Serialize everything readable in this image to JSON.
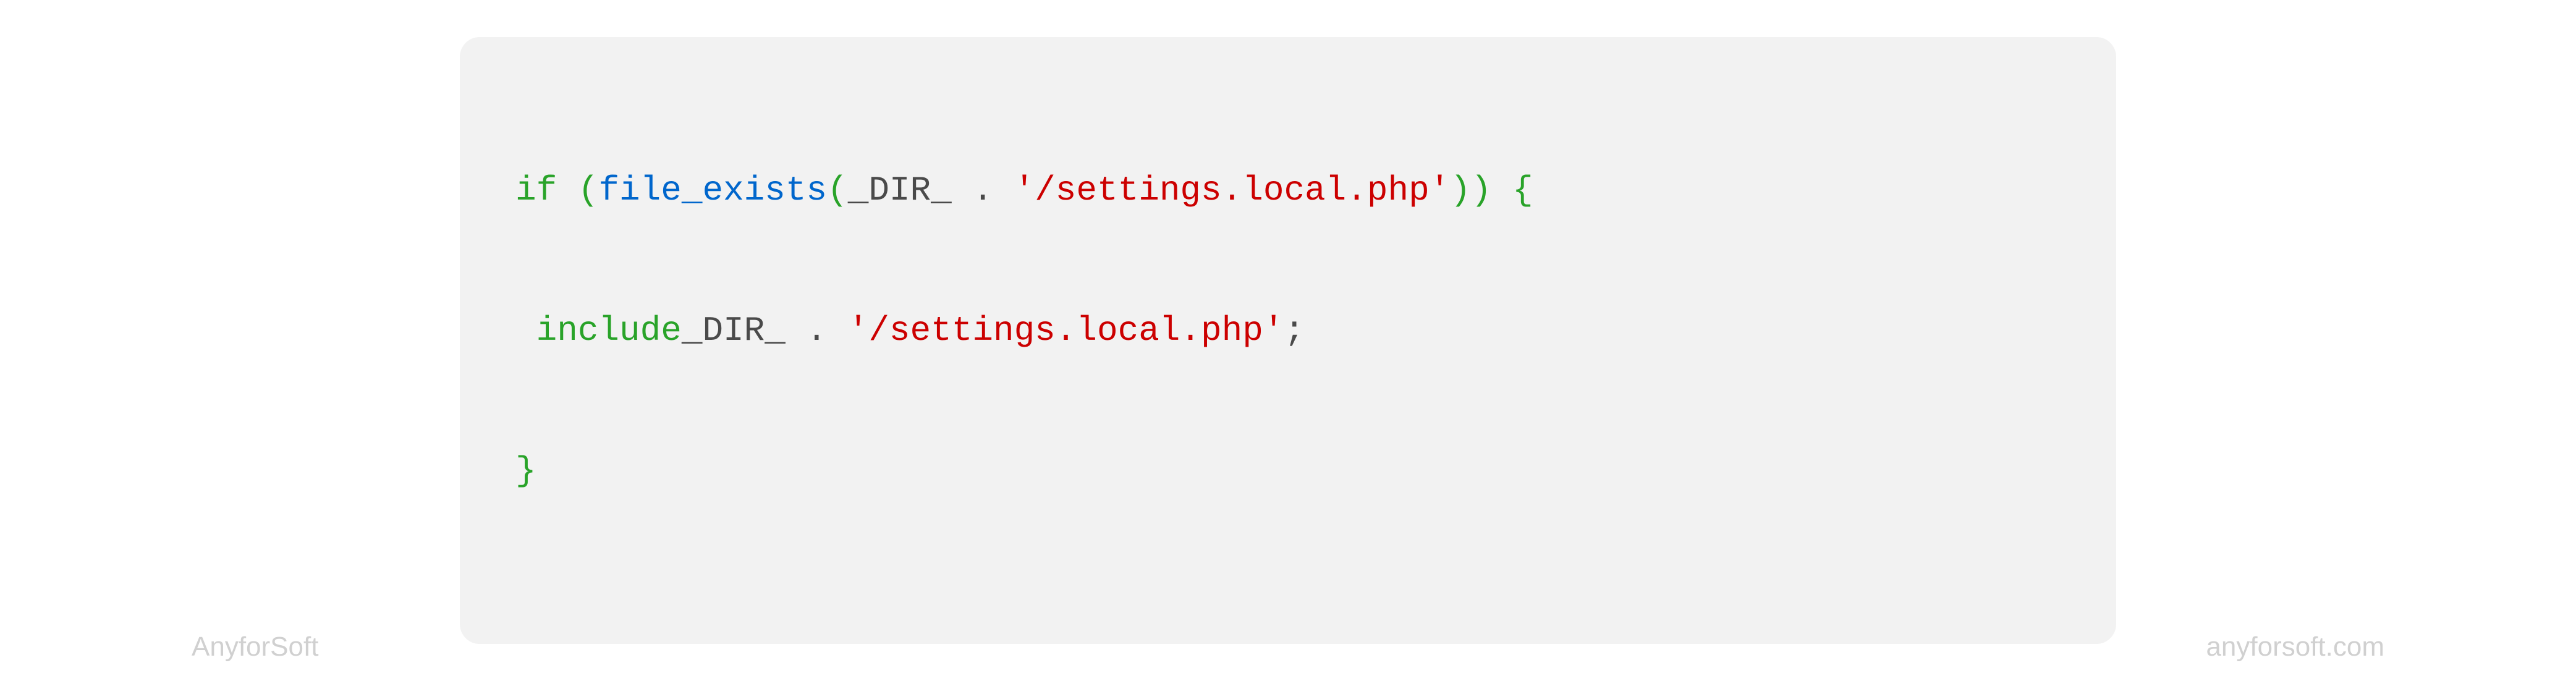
{
  "code": {
    "line1": {
      "if": "if",
      "space1": " ",
      "paren_open1": "(",
      "fn_name": "file_exists",
      "paren_open2": "(",
      "dir_const": "_DIR_ ",
      "dot1": ".",
      "space2": " ",
      "string1": "'/settings.local.php'",
      "paren_close1": ")",
      "paren_close2": ")",
      "space3": " ",
      "brace_open": "{"
    },
    "line2": {
      "indent": " ",
      "include": "include",
      "dir_const": "_DIR_ ",
      "dot": ".",
      "space": " ",
      "string": "'/settings.local.php'",
      "semi": ";"
    },
    "line3": {
      "brace_close": "}"
    }
  },
  "footer": {
    "brand": "AnyforSoft",
    "url": "anyforsoft.com"
  }
}
